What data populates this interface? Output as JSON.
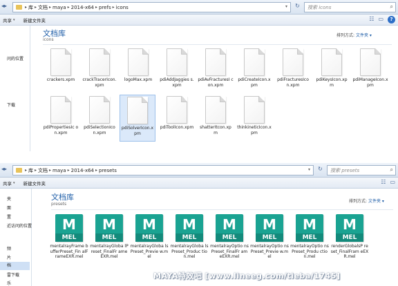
{
  "top_window": {
    "breadcrumb": [
      "库",
      "文档",
      "maya",
      "2014-x64",
      "prefs",
      "icons"
    ],
    "search_placeholder": "搜索 icons",
    "toolbar": {
      "share": "共享",
      "new_folder": "新建文件夹"
    },
    "nav_items": [
      "问的位置",
      "下载"
    ],
    "library_title": "文档库",
    "library_subtitle": "icons",
    "arrange_label": "排列方式:",
    "arrange_value": "文件夹",
    "files": [
      "crackers.xpm",
      "crackTracerIcon.xpm",
      "logoMax.xpm",
      "pdiAddJaggies s.xpm",
      "pdiAvFracturesI con.xpm",
      "pdiCreateIcon.x pm",
      "pdiFracturesIco n.xpm",
      "pdiKeysIcon.xp m",
      "pdiManageIcon.xpm",
      "pdiPropertiesIc on.xpm",
      "pdiSelectionIco n.xpm",
      "pdiSolverIcon.x pm",
      "pdiToolIcon.xpm",
      "shatterItcon.xp m",
      "thinkineticIcon.x pm"
    ],
    "selected_file": "pdiSolverIcon.x pm"
  },
  "bottom_window": {
    "breadcrumb": [
      "库",
      "文档",
      "maya",
      "2014-x64",
      "presets"
    ],
    "search_placeholder": "搜索 presets",
    "toolbar": {
      "share": "共享",
      "new_folder": "新建文件夹"
    },
    "nav_items": [
      "夹",
      "面",
      "置",
      "近访问的位置",
      "频",
      "片",
      "档",
      "雷下载",
      "乐"
    ],
    "library_title": "文档库",
    "library_subtitle": "presets",
    "arrange_label": "排列方式:",
    "arrange_value": "文件夹",
    "file_icon_text": "MEL",
    "files": [
      "mentalrayFrame bufferPreset_Fin alFrameEXR.mel",
      "mentalrayGloba lPreset_FinalFr ameEXR.mel",
      "mentalrayGloba lsPreset_Previe w.mel",
      "mentalrayGloba lsPreset_Produc tion.mel",
      "mentalrayOptio nsPreset_FinalFr ameEXR.mel",
      "mentalrayOptio nsPreset_Previe w.mel",
      "mentalrayOptio nsPreset_Produ ction.mel",
      "renderGlobalsP reset_FinalFram eEXR.mel"
    ]
  },
  "watermark": "MAYA特效吧 [www.lineeg.com/tieba/1745]",
  "colors": {
    "accent": "#1f5ea8",
    "mel_icon": "#1aa392",
    "selection": "#dbe9fa"
  }
}
